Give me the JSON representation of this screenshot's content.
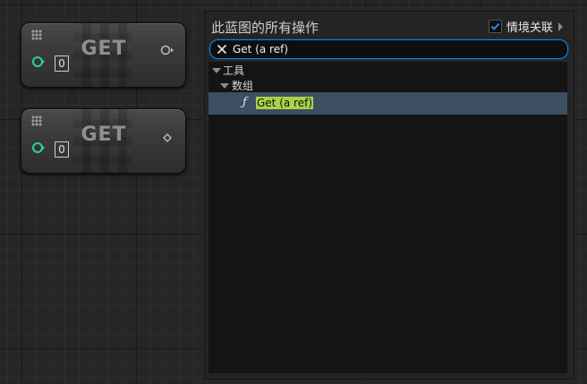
{
  "nodes": [
    {
      "title": "GET",
      "index": "0"
    },
    {
      "title": "GET",
      "index": "0"
    }
  ],
  "panel": {
    "title": "此蓝图的所有操作",
    "context_sensitive_label": "情境关联",
    "context_sensitive_checked": true,
    "search_value": "Get (a ref)",
    "tree": {
      "category": "工具",
      "subcategory": "数组",
      "item": "Get (a ref)",
      "item_icon": "function-icon"
    }
  },
  "colors": {
    "pin_exec_green": "#2fd0a0",
    "selection": "#3c4e62",
    "highlight": "#a9d449",
    "search_border": "#1e7fd0"
  }
}
